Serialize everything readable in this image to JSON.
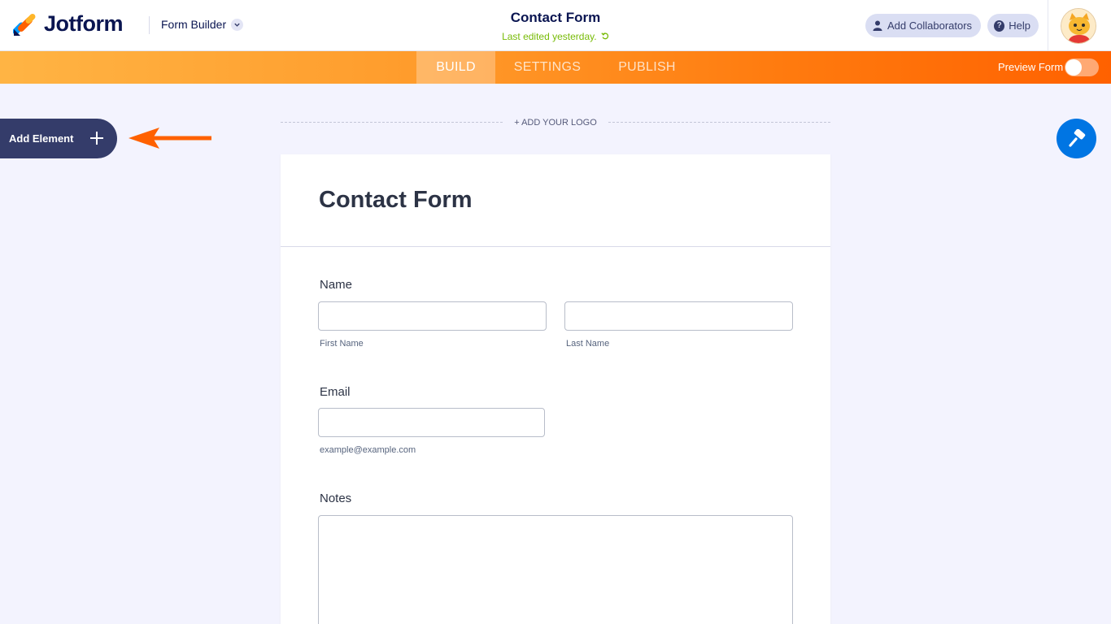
{
  "header": {
    "brand": "Jotform",
    "builder_menu": "Form Builder",
    "form_title": "Contact Form",
    "last_edited": "Last edited yesterday.",
    "add_collaborators": "Add Collaborators",
    "help": "Help"
  },
  "nav": {
    "tabs": [
      {
        "label": "BUILD",
        "active": true
      },
      {
        "label": "SETTINGS",
        "active": false
      },
      {
        "label": "PUBLISH",
        "active": false
      }
    ],
    "preview_label": "Preview Form",
    "preview_on": false
  },
  "sidebar": {
    "add_element": "Add Element"
  },
  "canvas": {
    "add_logo": "+ ADD YOUR LOGO"
  },
  "form": {
    "title": "Contact Form",
    "fields": {
      "name": {
        "label": "Name",
        "first_sublabel": "First Name",
        "last_sublabel": "Last Name"
      },
      "email": {
        "label": "Email",
        "sublabel": "example@example.com"
      },
      "notes": {
        "label": "Notes"
      }
    }
  },
  "colors": {
    "accent": "#ff6100",
    "navy": "#0a1551",
    "designer_blue": "#0075e3",
    "green_status": "#78bb07"
  },
  "icons": [
    "jotform-logo-icon",
    "chevron-down-icon",
    "user-icon",
    "help-icon",
    "avatar-cat-icon",
    "plus-icon",
    "arrow-left-icon",
    "paint-roller-icon",
    "undo-icon"
  ]
}
